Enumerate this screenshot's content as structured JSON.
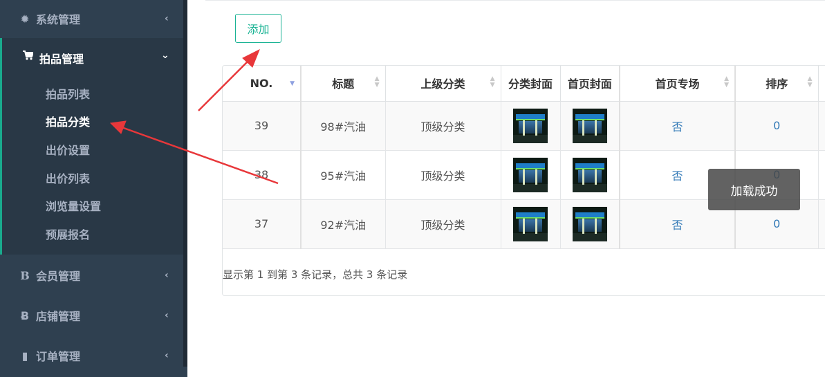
{
  "sidebar": {
    "items": [
      {
        "label": "系统管理",
        "icon": "gear-icon",
        "glyph": "✹",
        "chevron": "‹"
      },
      {
        "label": "拍品管理",
        "icon": "cart-icon",
        "glyph": "🛒",
        "chevron": "⌄",
        "children": [
          {
            "label": "拍品列表"
          },
          {
            "label": "拍品分类"
          },
          {
            "label": "出价设置"
          },
          {
            "label": "出价列表"
          },
          {
            "label": "浏览量设置"
          },
          {
            "label": "预展报名"
          }
        ]
      },
      {
        "label": "会员管理",
        "icon": "bold-b-icon",
        "glyph": "B",
        "chevron": "‹"
      },
      {
        "label": "店铺管理",
        "icon": "bitcoin-icon",
        "glyph": "Ƀ",
        "chevron": "‹"
      },
      {
        "label": "订单管理",
        "icon": "book-icon",
        "glyph": "▮",
        "chevron": "‹"
      }
    ]
  },
  "toolbar": {
    "add_label": "添加"
  },
  "table": {
    "columns": [
      "NO.",
      "标题",
      "上级分类",
      "分类封面",
      "首页封面",
      "首页专场",
      "排序"
    ],
    "rows": [
      {
        "no": "39",
        "title": "98#汽油",
        "parent": "顶级分类",
        "featured": "否",
        "sort": "0"
      },
      {
        "no": "38",
        "title": "95#汽油",
        "parent": "顶级分类",
        "featured": "否",
        "sort": "0"
      },
      {
        "no": "37",
        "title": "92#汽油",
        "parent": "顶级分类",
        "featured": "否",
        "sort": "0"
      }
    ]
  },
  "pagination": {
    "summary": "显示第 1 到第 3 条记录，总共 3 条记录"
  },
  "toast": {
    "message": "加载成功"
  },
  "colors": {
    "sidebar_bg": "#2f4050",
    "accent": "#1ab394",
    "link": "#337ab7",
    "arrow": "#e8373a"
  }
}
